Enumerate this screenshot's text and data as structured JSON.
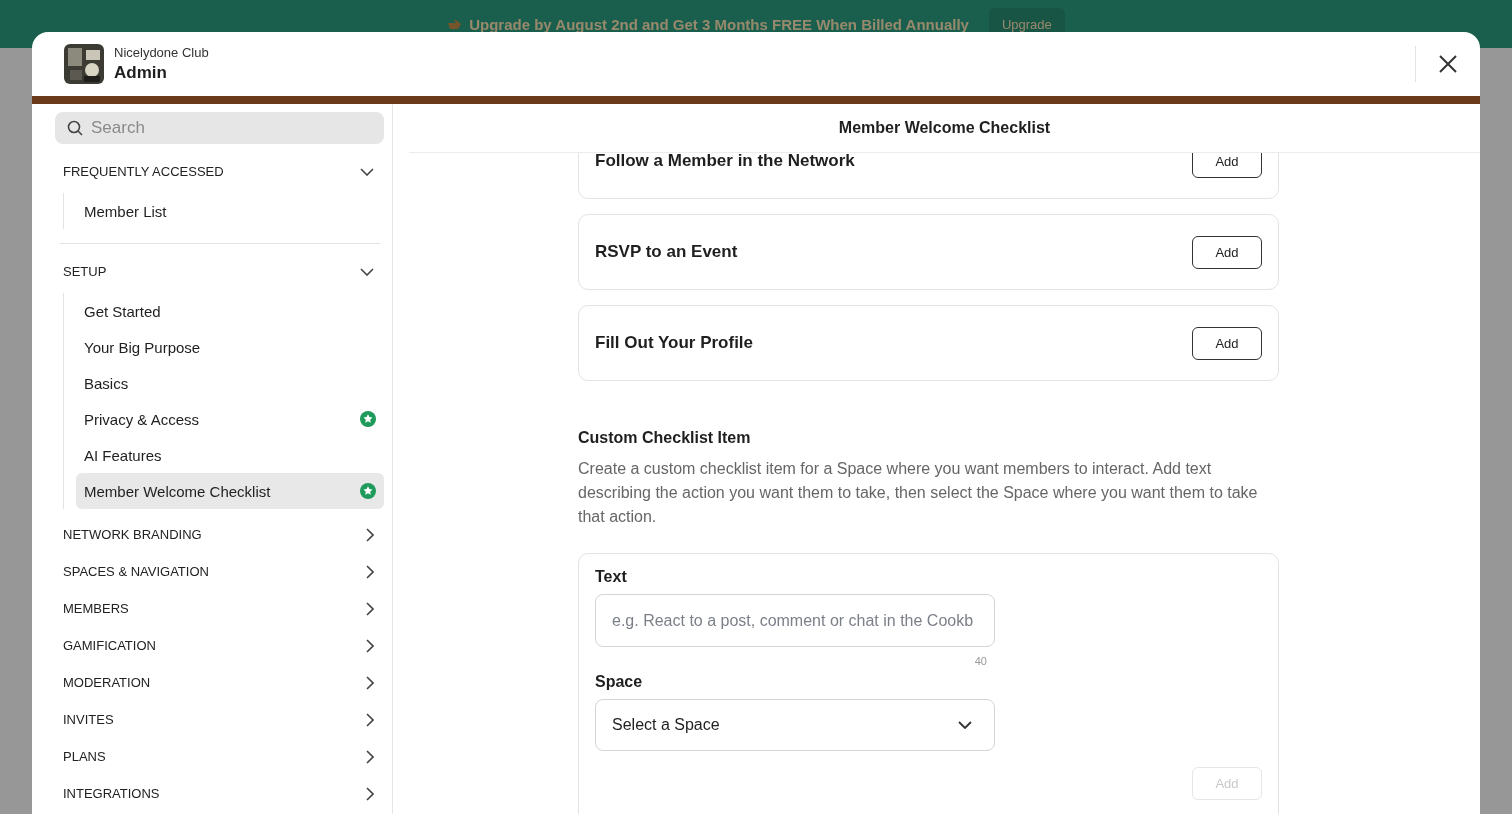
{
  "banner": {
    "text": "Upgrade by August 2nd and Get 3 Months FREE When Billed Annually",
    "button": "Upgrade"
  },
  "header": {
    "org": "Nicelydone Club",
    "title": "Admin"
  },
  "sidebar": {
    "search": {
      "placeholder": "Search"
    },
    "sections": [
      {
        "title": "FREQUENTLY ACCESSED",
        "expanded": true,
        "items": [
          {
            "label": "Member List",
            "selected": false,
            "starred": false
          }
        ]
      },
      {
        "title": "SETUP",
        "expanded": true,
        "items": [
          {
            "label": "Get Started",
            "selected": false,
            "starred": false
          },
          {
            "label": "Your Big Purpose",
            "selected": false,
            "starred": false
          },
          {
            "label": "Basics",
            "selected": false,
            "starred": false
          },
          {
            "label": "Privacy & Access",
            "selected": false,
            "starred": true
          },
          {
            "label": "AI Features",
            "selected": false,
            "starred": false
          },
          {
            "label": "Member Welcome Checklist",
            "selected": true,
            "starred": true
          }
        ]
      },
      {
        "title": "NETWORK BRANDING",
        "expanded": false
      },
      {
        "title": "SPACES & NAVIGATION",
        "expanded": false
      },
      {
        "title": "MEMBERS",
        "expanded": false
      },
      {
        "title": "GAMIFICATION",
        "expanded": false
      },
      {
        "title": "MODERATION",
        "expanded": false
      },
      {
        "title": "INVITES",
        "expanded": false
      },
      {
        "title": "PLANS",
        "expanded": false
      },
      {
        "title": "INTEGRATIONS",
        "expanded": false
      }
    ]
  },
  "main": {
    "title": "Member Welcome Checklist",
    "checklist": [
      {
        "label": "Follow a Member in the Network",
        "button": "Add"
      },
      {
        "label": "RSVP to an Event",
        "button": "Add"
      },
      {
        "label": "Fill Out Your Profile",
        "button": "Add"
      }
    ],
    "custom": {
      "heading": "Custom Checklist Item",
      "description": "Create a custom checklist item for a Space where you want members to interact. Add text describing the action you want them to take, then select the Space where you want them to take that action.",
      "text_label": "Text",
      "text_placeholder": "e.g. React to a post, comment or chat in the Cookb",
      "counter": "40",
      "space_label": "Space",
      "space_value": "Select a Space",
      "button": "Add",
      "button_disabled": true
    }
  }
}
